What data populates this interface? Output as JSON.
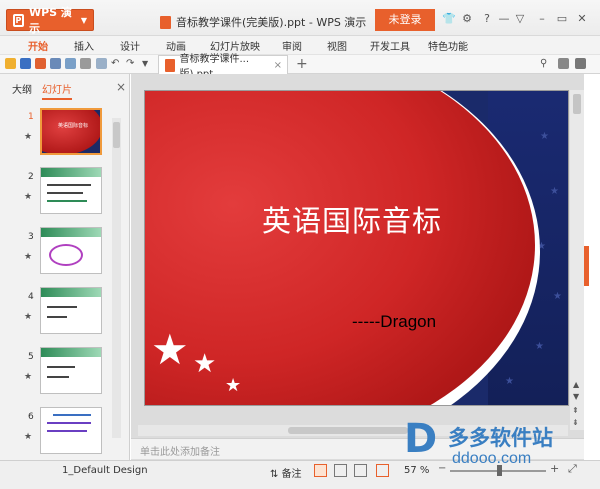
{
  "app": {
    "menu_button": "WPS 演示",
    "logo_letter": "P",
    "window_title": "音标教学课件(完美版).ppt - WPS 演示",
    "login_label": "未登录"
  },
  "ribbon_tabs": [
    "开始",
    "插入",
    "设计",
    "动画",
    "幻灯片放映",
    "审阅",
    "视图",
    "开发工具",
    "特色功能"
  ],
  "document_tab": {
    "label": "音标教学课件...版).ppt",
    "close": "×",
    "new_tab": "+"
  },
  "left_panel": {
    "tabs": [
      "大纲",
      "幻灯片"
    ],
    "close": "×",
    "slides": [
      "1",
      "2",
      "3",
      "4",
      "5",
      "6"
    ],
    "thumb1_title": "英语国际音标"
  },
  "slide": {
    "title": "英语国际音标",
    "subtitle": "-----Dragon"
  },
  "notes_placeholder": "单击此处添加备注",
  "status": {
    "design": "1_Default Design",
    "notes_button": "备注",
    "zoom": "57 %",
    "zoom_fraction": 0.57
  },
  "watermark": {
    "logo": "D",
    "line1": "多多软件站",
    "line2": "ddooo.com"
  },
  "colors": {
    "accent": "#e8602c",
    "slide_red": "#cf2626",
    "slide_blue": "#1a2a6a"
  }
}
